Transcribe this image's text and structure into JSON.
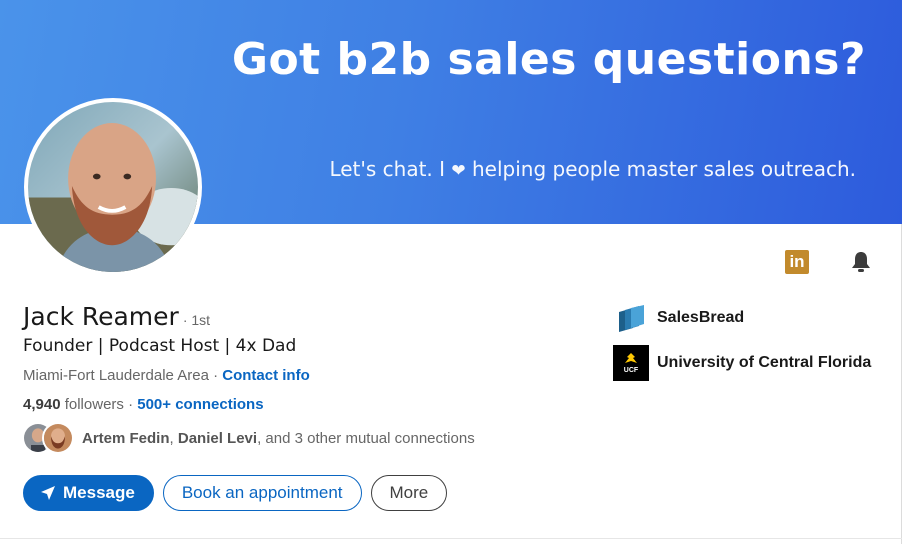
{
  "banner": {
    "headline": "Got b2b sales questions?",
    "sub_before": "Let's chat. I ",
    "sub_heart": "❤",
    "sub_after": " helping people master sales outreach.",
    "gradient_start": "#4a93ea",
    "gradient_end": "#2d5bdc"
  },
  "profile": {
    "name": "Jack Reamer",
    "degree": "· 1st",
    "headline": "Founder | Podcast Host | 4x Dad",
    "location": "Miami-Fort Lauderdale Area",
    "location_sep": " · ",
    "contact_link": "Contact info",
    "followers_count": "4,940",
    "followers_label": " followers",
    "connections_sep": "  · ",
    "connections_link": "500+ connections",
    "mutual": {
      "name1": "Artem Fedin",
      "sep": ", ",
      "name2": "Daniel Levi",
      "rest": ", and 3 other mutual connections"
    }
  },
  "icons": {
    "linkedin": "linkedin-icon",
    "linkedin_glyph": "in",
    "bell": "bell-icon",
    "message": "paper-plane-icon"
  },
  "actions": {
    "message_label": "Message",
    "appointment_label": "Book an appointment",
    "more_label": "More"
  },
  "orgs": [
    {
      "name": "SalesBread",
      "logo": "salesbread-logo"
    },
    {
      "name": "University of Central Florida",
      "logo": "ucf-logo",
      "logo_text": "UCF"
    }
  ],
  "colors": {
    "accent": "#0a66c2",
    "linkedin_badge": "#c28a2c"
  }
}
